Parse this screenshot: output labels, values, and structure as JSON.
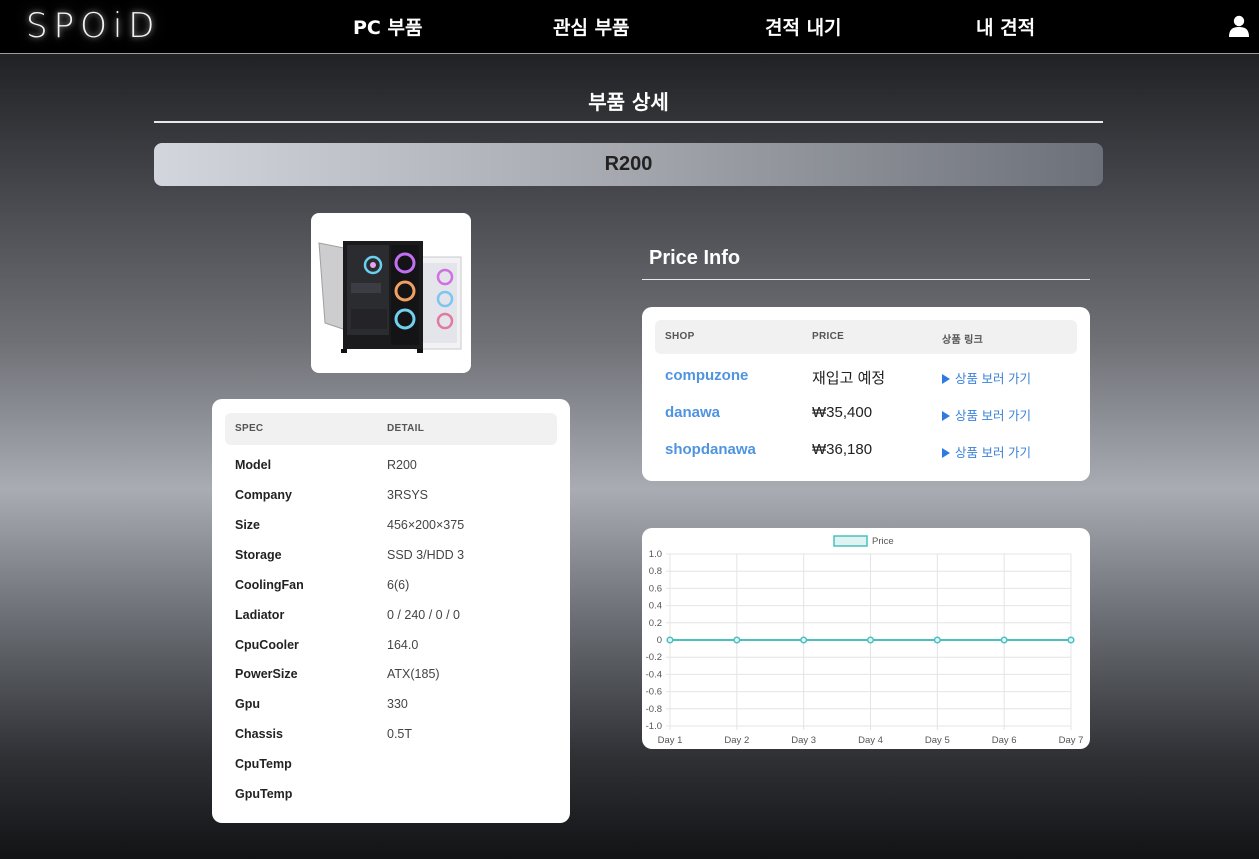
{
  "header": {
    "logo": "SPOiD",
    "nav": [
      "PC 부품",
      "관심 부품",
      "견적 내기",
      "내 견적"
    ]
  },
  "page": {
    "title": "부품 상세",
    "product_name": "R200"
  },
  "spec_table": {
    "headers": [
      "SPEC",
      "DETAIL"
    ],
    "rows": [
      {
        "spec": "Model",
        "detail": "R200"
      },
      {
        "spec": "Company",
        "detail": "3RSYS"
      },
      {
        "spec": "Size",
        "detail": "456×200×375"
      },
      {
        "spec": "Storage",
        "detail": "SSD 3/HDD 3"
      },
      {
        "spec": "CoolingFan",
        "detail": "6(6)"
      },
      {
        "spec": "Ladiator",
        "detail": "0 / 240 / 0 / 0"
      },
      {
        "spec": "CpuCooler",
        "detail": "164.0"
      },
      {
        "spec": "PowerSize",
        "detail": "ATX(185)"
      },
      {
        "spec": "Gpu",
        "detail": "330"
      },
      {
        "spec": "Chassis",
        "detail": "0.5T"
      },
      {
        "spec": "CpuTemp",
        "detail": ""
      },
      {
        "spec": "GpuTemp",
        "detail": ""
      }
    ]
  },
  "price_info": {
    "title": "Price Info",
    "headers": [
      "SHOP",
      "PRICE",
      "상품 링크"
    ],
    "rows": [
      {
        "shop": "compuzone",
        "price": "재입고 예정",
        "link": "상품 보러 가기"
      },
      {
        "shop": "danawa",
        "price": "₩35,400",
        "link": "상품 보러 가기"
      },
      {
        "shop": "shopdanawa",
        "price": "₩36,180",
        "link": "상품 보러 가기"
      }
    ]
  },
  "colors": {
    "accent_link": "#4f94e0",
    "chart_line": "#4bc0c0"
  },
  "chart_data": {
    "type": "line",
    "categories": [
      "Day 1",
      "Day 2",
      "Day 3",
      "Day 4",
      "Day 5",
      "Day 6",
      "Day 7"
    ],
    "series": [
      {
        "name": "Price",
        "values": [
          0,
          0,
          0,
          0,
          0,
          0,
          0
        ]
      }
    ],
    "yticks": [
      "1.0",
      "0.8",
      "0.6",
      "0.4",
      "0.2",
      "0",
      "-0.2",
      "-0.4",
      "-0.6",
      "-0.8",
      "-1.0"
    ],
    "ylim": [
      -1.0,
      1.0
    ],
    "grid": true,
    "legend": "top-center"
  }
}
